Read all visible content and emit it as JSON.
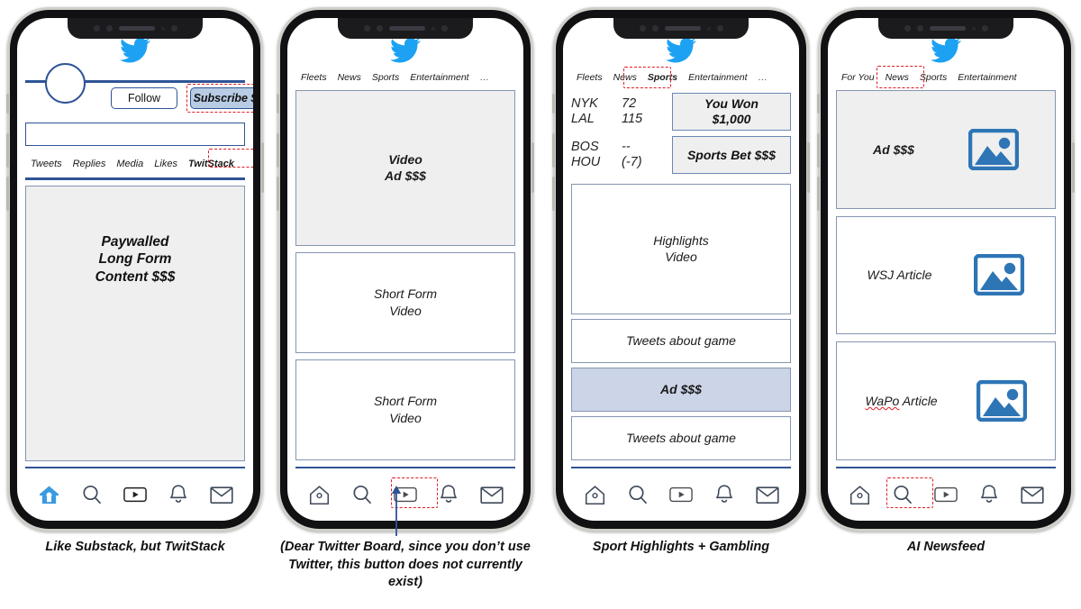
{
  "brand": {
    "logo_icon": "twitter-bird-icon",
    "accent_blue": "#1da1f2",
    "frame_blue": "#2f5496",
    "card_border": "#8496b0",
    "card_grey": "#efefef",
    "highlight_blue": "#ccd5e8",
    "subscribe_fill": "#b8cce4",
    "annotation_red": "#e01b24",
    "image_icon_blue": "#2e75b6"
  },
  "bottom_nav": {
    "items": [
      {
        "icon": "home-icon",
        "name": "home"
      },
      {
        "icon": "search-icon",
        "name": "search"
      },
      {
        "icon": "video-icon",
        "name": "video"
      },
      {
        "icon": "bell-icon",
        "name": "notifications"
      },
      {
        "icon": "envelope-icon",
        "name": "messages"
      }
    ]
  },
  "phones": [
    {
      "id": "twitstack",
      "caption": "Like Substack, but TwitStack",
      "profile": {
        "avatar_icon": "avatar-circle-icon",
        "follow_label": "Follow",
        "subscribe_label": "Subscribe $",
        "subscribe_highlighted": true,
        "search_value": "",
        "search_placeholder": ""
      },
      "profile_tabs": [
        {
          "label": "Tweets",
          "active": false,
          "highlighted": false
        },
        {
          "label": "Replies",
          "active": false,
          "highlighted": false
        },
        {
          "label": "Media",
          "active": false,
          "highlighted": false
        },
        {
          "label": "Likes",
          "active": false,
          "highlighted": false
        },
        {
          "label": "TwitStack",
          "active": true,
          "highlighted": true
        }
      ],
      "content_card": "Paywalled\nLong Form\nContent $$$",
      "nav_active_index": 0,
      "nav_highlight_index": -1
    },
    {
      "id": "short-form-video",
      "caption": "(Dear Twitter Board, since you don’t use Twitter, this button does not currently exist)",
      "feed_tabs": [
        {
          "label": "Fleets",
          "highlighted": false
        },
        {
          "label": "News",
          "highlighted": false
        },
        {
          "label": "Sports",
          "highlighted": false
        },
        {
          "label": "Entertainment",
          "highlighted": false
        },
        {
          "label": "…",
          "highlighted": false
        }
      ],
      "cards": [
        {
          "text": "Video\nAd $$$",
          "style": "grey-bold",
          "flex": 1.55
        },
        {
          "text": "Short Form\nVideo",
          "style": "plain",
          "flex": 1
        },
        {
          "text": "Short Form\nVideo",
          "style": "plain",
          "flex": 1
        }
      ],
      "nav_active_index": -1,
      "nav_highlight_index": 2
    },
    {
      "id": "sports-gambling",
      "caption": "Sport Highlights + Gambling",
      "feed_tabs": [
        {
          "label": "Fleets",
          "highlighted": false
        },
        {
          "label": "News",
          "highlighted": false
        },
        {
          "label": "Sports",
          "highlighted": true
        },
        {
          "label": "Entertainment",
          "highlighted": false
        },
        {
          "label": "…",
          "highlighted": false
        }
      ],
      "scores": [
        {
          "team_away": "NYK",
          "team_home": "LAL",
          "score_away": "72",
          "score_home": "115",
          "badge": "You Won\n$1,000"
        },
        {
          "team_away": "BOS",
          "team_home": "HOU",
          "score_away": "--",
          "score_home": "(-7)",
          "badge": "Sports Bet $$$"
        }
      ],
      "cards": [
        {
          "text": "Highlights\nVideo",
          "style": "plain",
          "flex": 2.5
        },
        {
          "text": "Tweets about game",
          "style": "plain",
          "flex": 0.82
        },
        {
          "text": "Ad $$$",
          "style": "highlight",
          "flex": 0.82
        },
        {
          "text": "Tweets about game",
          "style": "plain",
          "flex": 0.82
        }
      ],
      "nav_active_index": -1,
      "nav_highlight_index": -1
    },
    {
      "id": "ai-newsfeed",
      "caption": "AI Newsfeed",
      "feed_tabs": [
        {
          "label": "For You",
          "highlighted": false
        },
        {
          "label": "News",
          "highlighted": true
        },
        {
          "label": "Sports",
          "highlighted": false
        },
        {
          "label": "Entertainment",
          "highlighted": false
        }
      ],
      "articles": [
        {
          "label": "Ad $$$",
          "style": "grey-bold",
          "thumb": "image-placeholder-icon",
          "wavy": false
        },
        {
          "label": "WSJ Article",
          "style": "plain",
          "thumb": "image-placeholder-icon",
          "wavy": false
        },
        {
          "label": "WaPo Article",
          "style": "plain",
          "thumb": "image-placeholder-icon",
          "wavy": true,
          "wavy_part": "WaPo",
          "rest_part": " Article"
        }
      ],
      "nav_active_index": -1,
      "nav_highlight_index": 1
    }
  ]
}
